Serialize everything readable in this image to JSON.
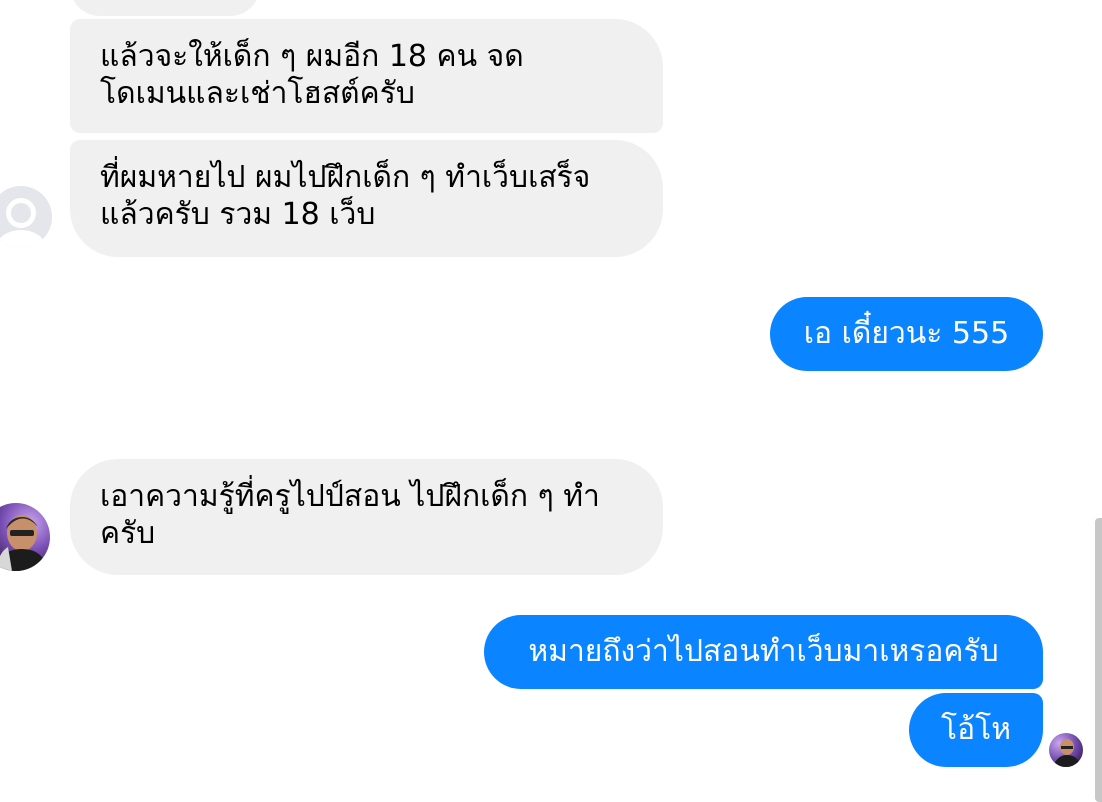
{
  "thread": {
    "incoming": [
      {
        "text": "แล้วจะให้เด็ก ๆ ผมอีก 18 คน จด\nโดเมนและเช่าโฮสต์ครับ"
      },
      {
        "text": "ที่ผมหายไป ผมไปฝึกเด็ก ๆ ทำเว็บเสร็จ\nแล้วครับ รวม 18 เว็บ"
      },
      {
        "text": "เอาความรู้ที่ครูไปป์สอน ไปฝึกเด็ก ๆ ทำ\nครับ"
      }
    ],
    "outgoing": [
      {
        "text": "เอ เดี๋ยวนะ 555"
      },
      {
        "text": "หมายถึงว่าไปสอนทำเว็บมาเหรอครับ"
      },
      {
        "text": "โอ้โห"
      }
    ]
  },
  "colors": {
    "incoming_bubble": "#f0f0f0",
    "outgoing_bubble": "#0a84ff",
    "incoming_text": "#000000",
    "outgoing_text": "#ffffff"
  },
  "icons": {
    "default_avatar": "default-avatar-icon",
    "contact_photo": "contact-photo-avatar",
    "read_receipt": "read-receipt-avatar"
  }
}
